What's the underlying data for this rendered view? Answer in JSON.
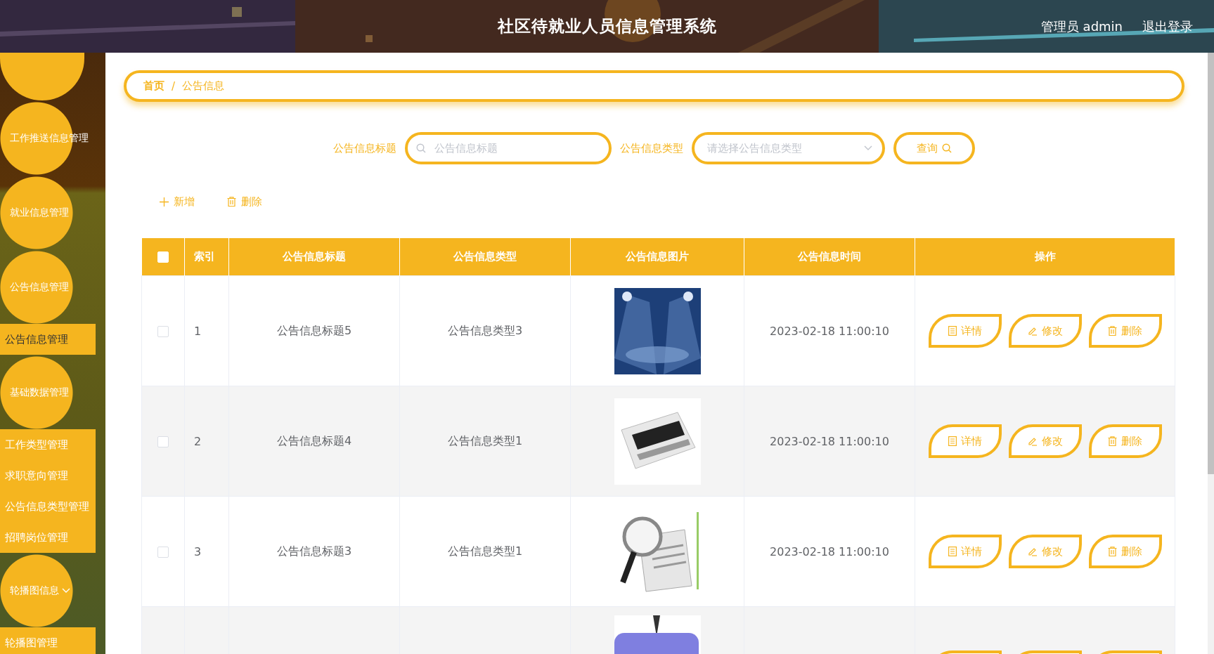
{
  "header": {
    "title": "社区待就业人员信息管理系统",
    "user": "管理员 admin",
    "logout": "退出登录"
  },
  "sidebar": {
    "items": [
      {
        "kind": "bubble"
      },
      {
        "kind": "menu",
        "label": "工作推送信息管理",
        "has_caret": false
      },
      {
        "kind": "menu",
        "label": "就业信息管理",
        "has_caret": false
      },
      {
        "kind": "menu",
        "label": "公告信息管理",
        "has_caret": false,
        "children": [
          {
            "label": "公告信息管理",
            "selected": true
          }
        ]
      },
      {
        "kind": "menu",
        "label": "基础数据管理",
        "has_caret": false,
        "children": [
          {
            "label": "工作类型管理",
            "selected": false
          },
          {
            "label": "求职意向管理",
            "selected": false
          },
          {
            "label": "公告信息类型管理",
            "selected": false
          },
          {
            "label": "招聘岗位管理",
            "selected": false
          }
        ]
      },
      {
        "kind": "menu",
        "label": "轮播图信息",
        "has_caret": true,
        "children": [
          {
            "label": "轮播图管理",
            "selected": false
          }
        ]
      }
    ]
  },
  "breadcrumb": {
    "items": [
      "首页",
      "公告信息"
    ],
    "separator": "/"
  },
  "search": {
    "fields": [
      {
        "kind": "text",
        "label": "公告信息标题",
        "placeholder": "公告信息标题"
      },
      {
        "kind": "select",
        "label": "公告信息类型",
        "placeholder": "请选择公告信息类型"
      }
    ],
    "button": "查询"
  },
  "toolbar": [
    {
      "kind": "add",
      "label": "新增"
    },
    {
      "kind": "delete",
      "label": "删除"
    }
  ],
  "table": {
    "columns": [
      {
        "kind": "checkbox",
        "checked": false
      },
      {
        "kind": "text",
        "label": "索引"
      },
      {
        "kind": "text",
        "label": "公告信息标题"
      },
      {
        "kind": "text",
        "label": "公告信息类型"
      },
      {
        "kind": "text",
        "label": "公告信息图片"
      },
      {
        "kind": "text",
        "label": "公告信息时间"
      },
      {
        "kind": "text",
        "label": "操作"
      }
    ],
    "rows": [
      {
        "kind": "full",
        "checked": false,
        "index": "1",
        "title": "公告信息标题5",
        "type": "公告信息类型3",
        "time": "2023-02-18 11:00:10",
        "actions": [
          {
            "kind": "detail",
            "label": "详情"
          },
          {
            "kind": "edit",
            "label": "修改"
          },
          {
            "kind": "delete",
            "label": "删除"
          }
        ]
      },
      {
        "kind": "full",
        "checked": false,
        "index": "2",
        "title": "公告信息标题4",
        "type": "公告信息类型1",
        "time": "2023-02-18 11:00:10",
        "actions": [
          {
            "kind": "detail",
            "label": "详情"
          },
          {
            "kind": "edit",
            "label": "修改"
          },
          {
            "kind": "delete",
            "label": "删除"
          }
        ]
      },
      {
        "kind": "full",
        "checked": false,
        "index": "3",
        "title": "公告信息标题3",
        "type": "公告信息类型1",
        "time": "2023-02-18 11:00:10",
        "actions": [
          {
            "kind": "detail",
            "label": "详情"
          },
          {
            "kind": "edit",
            "label": "修改"
          },
          {
            "kind": "delete",
            "label": "删除"
          }
        ]
      },
      {
        "kind": "cut"
      }
    ]
  }
}
